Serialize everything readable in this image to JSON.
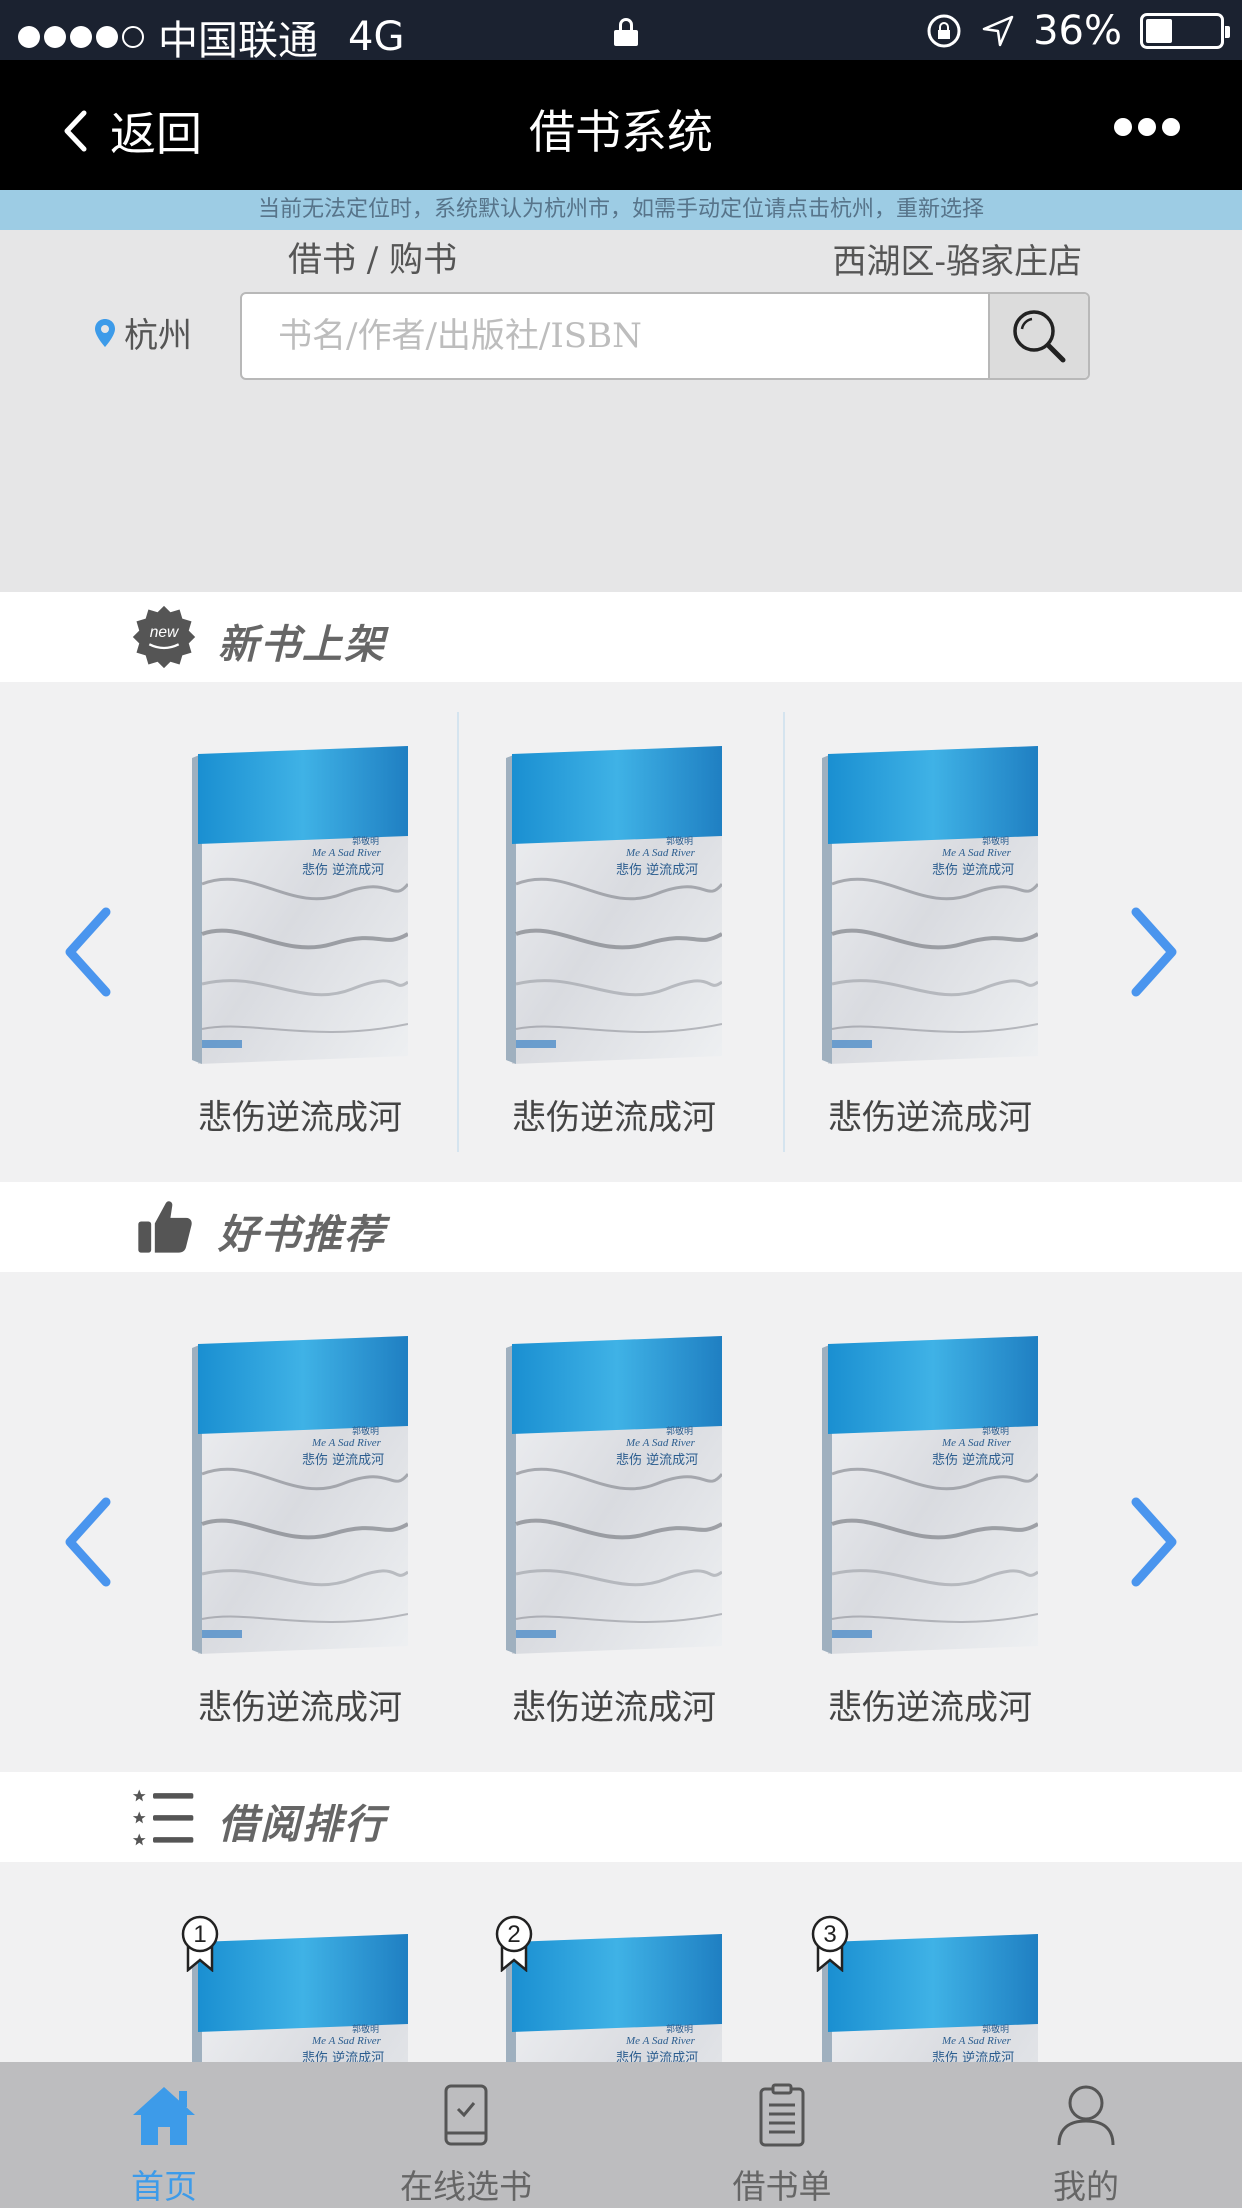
{
  "status_bar": {
    "carrier": "中国联通",
    "network": "4G",
    "battery": "36%",
    "battery_level": 0.36
  },
  "nav": {
    "back_label": "返回",
    "title": "借书系统"
  },
  "notice": "当前无法定位时，系统默认为杭州市，如需手动定位请点击杭州，重新选择",
  "search": {
    "mode_tabs": "借书 / 购书",
    "store": "西湖区-骆家庄店",
    "city": "杭州",
    "placeholder": "书名/作者/出版社/ISBN"
  },
  "sections": {
    "new_books": {
      "title": "新书上架",
      "badge": "new",
      "books": [
        {
          "title": "悲伤逆流成河"
        },
        {
          "title": "悲伤逆流成河"
        },
        {
          "title": "悲伤逆流成河"
        }
      ]
    },
    "recommended": {
      "title": "好书推荐",
      "books": [
        {
          "title": "悲伤逆流成河"
        },
        {
          "title": "悲伤逆流成河"
        },
        {
          "title": "悲伤逆流成河"
        }
      ]
    },
    "ranking": {
      "title": "借阅排行",
      "books": [
        {
          "rank": "1"
        },
        {
          "rank": "2"
        },
        {
          "rank": "3"
        }
      ]
    }
  },
  "cover_text": {
    "en": "Me A Sad River",
    "zh": "悲伤 逆流成河",
    "author": "郭敬明"
  },
  "tabbar": {
    "items": [
      {
        "label": "首页",
        "icon": "home-icon"
      },
      {
        "label": "在线选书",
        "icon": "phone-icon"
      },
      {
        "label": "借书单",
        "icon": "clipboard-icon"
      },
      {
        "label": "我的",
        "icon": "user-icon"
      }
    ],
    "active_color": "#3d9be9"
  },
  "colors": {
    "accent": "#4a95ee",
    "nav_bg": "#000000",
    "notice_bg": "#9dcce4"
  }
}
